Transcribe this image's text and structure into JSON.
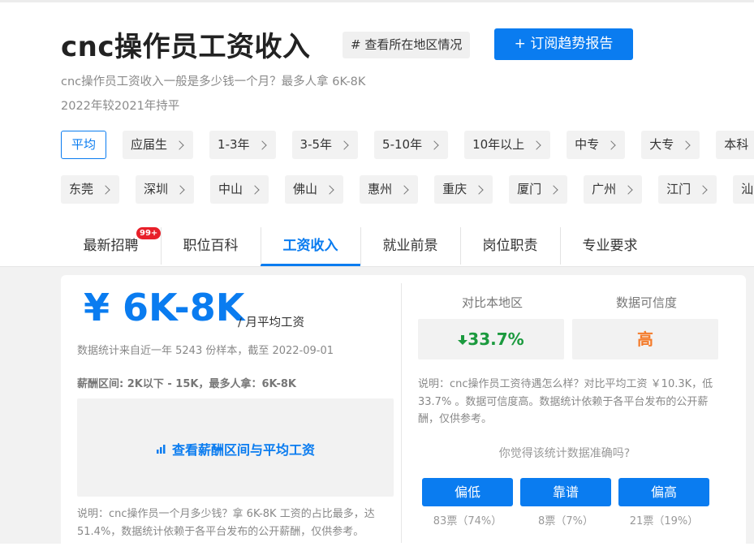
{
  "header": {
    "title": "cnc操作员工资收入",
    "region_button": "# 查看所在地区情况",
    "subscribe_button": "+ 订阅趋势报告",
    "subtitle": "cnc操作员工资收入一般是多少钱一个月？最多人拿 6K-8K",
    "trend": "2022年较2021年持平"
  },
  "filters": {
    "experience": [
      "平均",
      "应届生",
      "1-3年",
      "3-5年",
      "5-10年",
      "10年以上",
      "中专",
      "大专",
      "本科"
    ],
    "active": "平均",
    "cities": [
      "东莞",
      "深圳",
      "中山",
      "佛山",
      "惠州",
      "重庆",
      "厦门",
      "广州",
      "江门",
      "汕"
    ]
  },
  "tabs": {
    "items": [
      "最新招聘",
      "职位百科",
      "工资收入",
      "就业前景",
      "岗位职责",
      "专业要求"
    ],
    "active": "工资收入",
    "badge": "99+"
  },
  "salary": {
    "main": "¥ 6K-8K",
    "unit": "/ 月平均工资",
    "source": "数据统计来自近一年 5243 份样本，截至 2022-09-01",
    "range": "薪酬区间: 2K以下 - 15K，最多人拿：6K-8K",
    "chart_link": "查看薪酬区间与平均工资",
    "note": "说明：cnc操作员一个月多少钱？拿 6K-8K 工资的占比最多，达 51.4%，数据统计依赖于各平台发布的公开薪酬，仅供参考。"
  },
  "compare": {
    "label_region": "对比本地区",
    "label_reliability": "数据可信度",
    "region_value": "33.7%",
    "reliability_value": "高",
    "note": "说明：cnc操作员工资待遇怎么样？对比平均工资 ￥10.3K，低 33.7% 。数据可信度高。数据统计依赖于各平台发布的公开薪酬，仅供参考。",
    "question": "你觉得该统计数据准确吗?",
    "votes": [
      {
        "label": "偏低",
        "count": "83票（74%）"
      },
      {
        "label": "靠谱",
        "count": "8票（7%）"
      },
      {
        "label": "偏高",
        "count": "21票（19%）"
      }
    ]
  },
  "colors": {
    "accent": "#0a7cf0",
    "down": "#1b9a3e",
    "high": "#f47b2a",
    "badge": "#e8202a"
  }
}
